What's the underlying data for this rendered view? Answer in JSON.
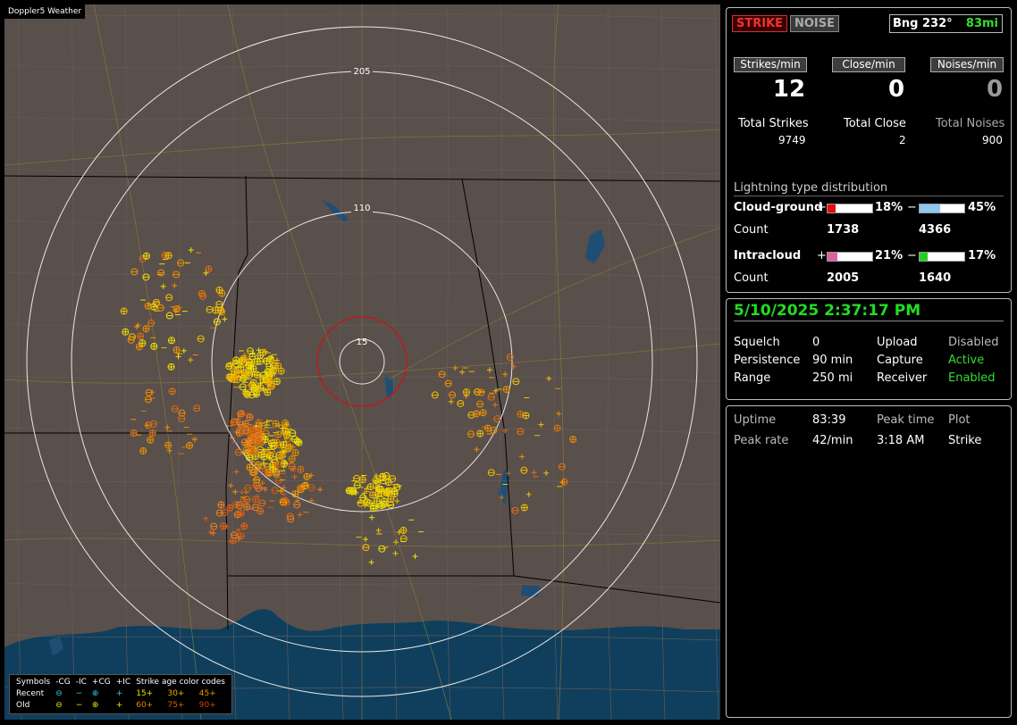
{
  "map": {
    "title": "Doppler5 Weather",
    "rings": [
      "205",
      "110",
      "15"
    ],
    "legend": {
      "header": [
        "Symbols",
        "-CG",
        "-IC",
        "+CG",
        "+IC",
        "Strike age color codes"
      ],
      "recent_label": "Recent",
      "old_label": "Old",
      "recent_codes": [
        "15+",
        "30+",
        "45+"
      ],
      "old_codes": [
        "60+",
        "75+",
        "90+"
      ]
    }
  },
  "status": {
    "strike_btn": "STRIKE",
    "noise_btn": "NOISE",
    "bng": "Bng 232°",
    "bng_dist": "83mi",
    "labels": [
      "Strikes/min",
      "Close/min",
      "Noises/min"
    ],
    "rates": [
      "12",
      "0",
      "0"
    ],
    "totals_labels": [
      "Total Strikes",
      "Total Close",
      "Total Noises"
    ],
    "totals": [
      "9749",
      "2",
      "900"
    ],
    "dist_title": "Lightning type distribution",
    "cg_label": "Cloud-ground",
    "ic_label": "Intracloud",
    "count_label": "Count",
    "plus": "+",
    "minus": "−",
    "cg_pos_pct": "18%",
    "cg_neg_pct": "45%",
    "cg_pos_count": "1738",
    "cg_neg_count": "4366",
    "ic_pos_pct": "21%",
    "ic_neg_pct": "17%",
    "ic_pos_count": "2005",
    "ic_neg_count": "1640",
    "bar_fill": {
      "cg_pos": 0.18,
      "cg_neg": 0.45,
      "ic_pos": 0.21,
      "ic_neg": 0.17
    },
    "colors": {
      "cg_pos": "#e01010",
      "cg_neg": "#8ec8f0",
      "ic_pos": "#e060a0",
      "ic_neg": "#20d020"
    }
  },
  "settings": {
    "datetime": "5/10/2025 2:37:17 PM",
    "squelch_label": "Squelch",
    "squelch": "0",
    "upload_label": "Upload",
    "upload": "Disabled",
    "persistence_label": "Persistence",
    "persistence": "90 min",
    "capture_label": "Capture",
    "capture": "Active",
    "range_label": "Range",
    "range": "250 mi",
    "receiver_label": "Receiver",
    "receiver": "Enabled"
  },
  "stats": {
    "uptime_label": "Uptime",
    "uptime": "83:39",
    "peak_time_label": "Peak time",
    "plot_label": "Plot",
    "peak_rate_label": "Peak rate",
    "peak_rate": "42/min",
    "peak_time": "3:18 AM",
    "plot": "Strike"
  }
}
